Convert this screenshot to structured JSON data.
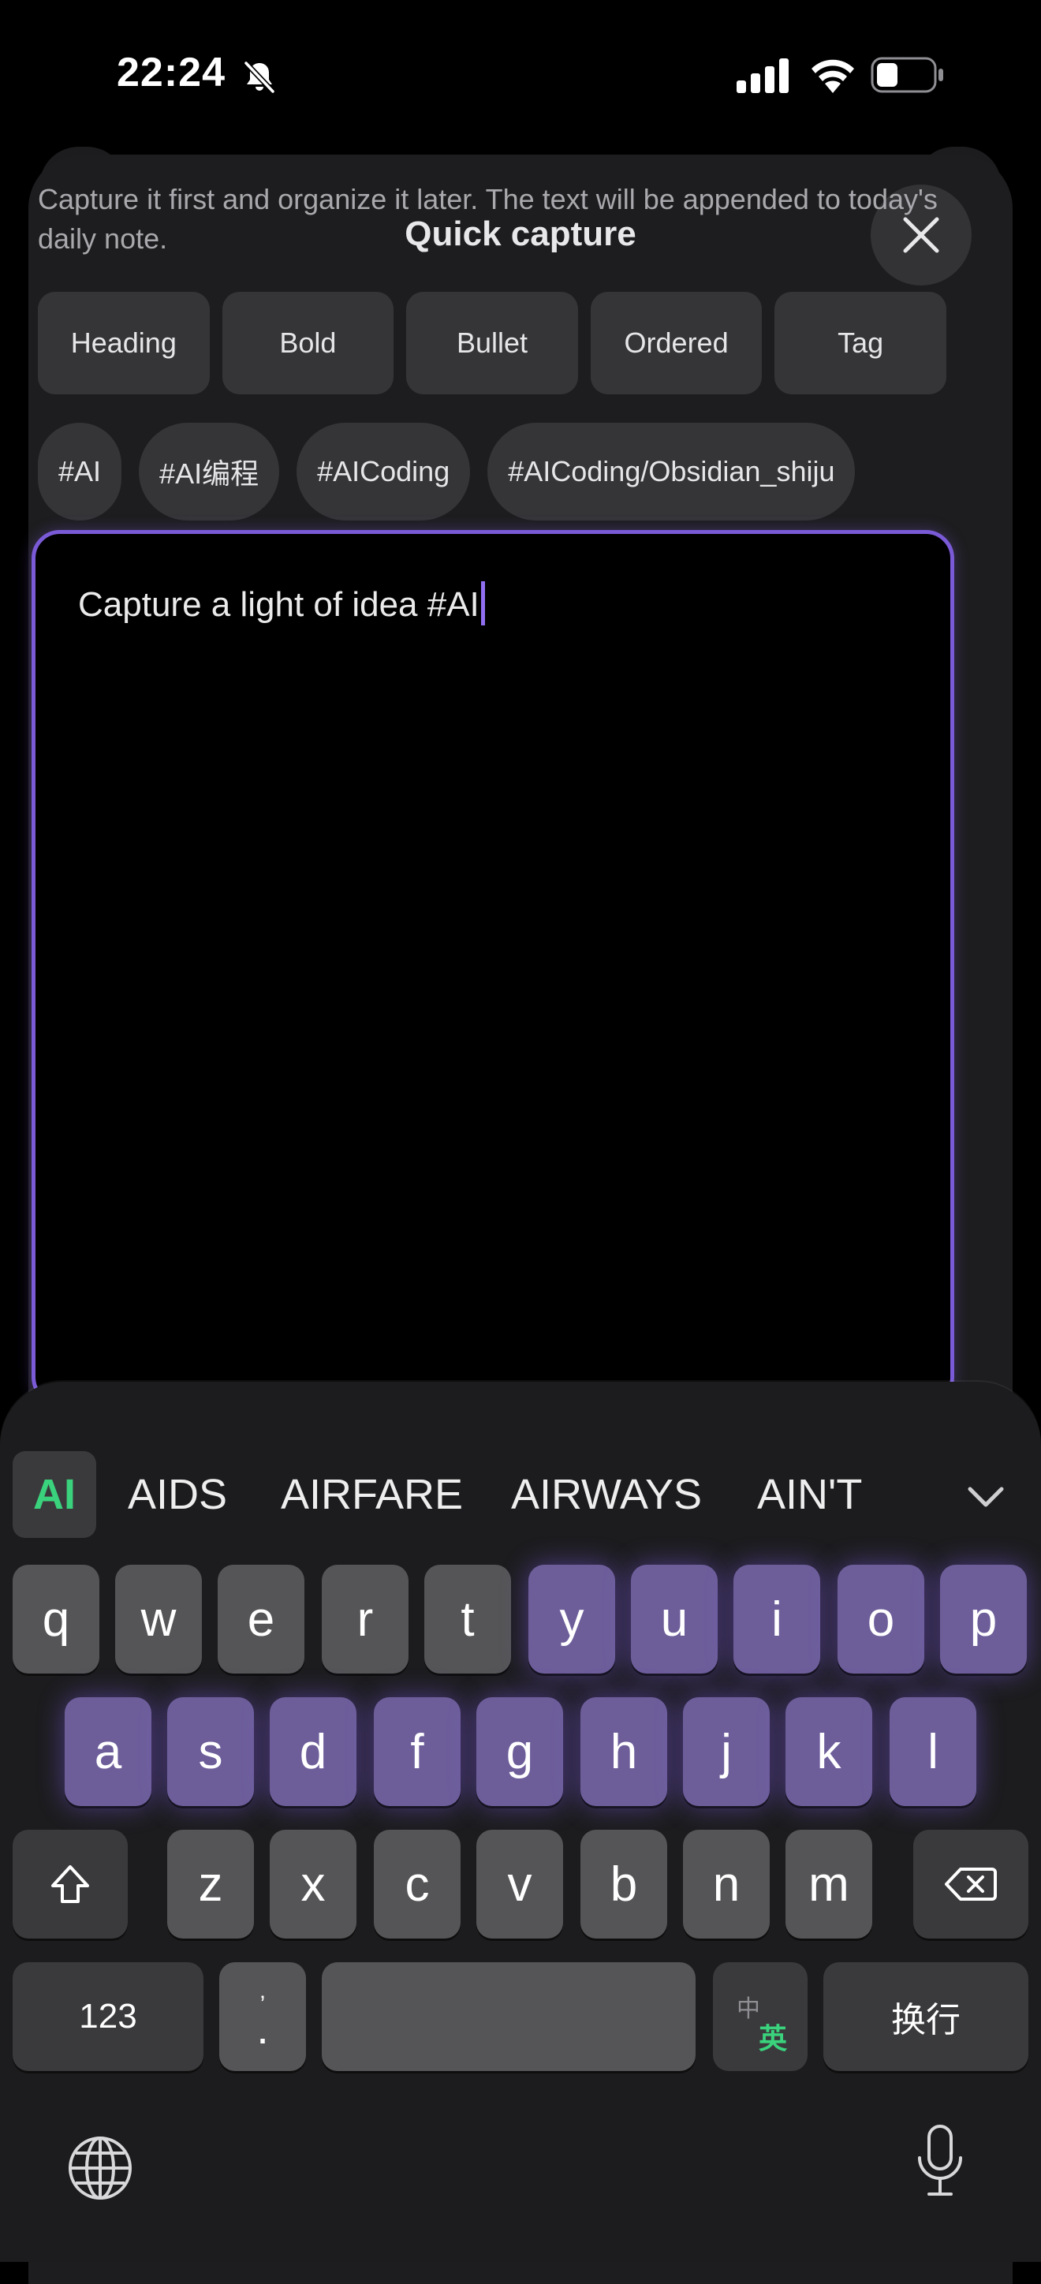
{
  "status_bar": {
    "time": "22:24",
    "icons": [
      "bell-slash-icon",
      "cellular-signal-icon",
      "wifi-icon",
      "battery-icon"
    ]
  },
  "sheet": {
    "title": "Quick capture",
    "description": "Capture it first and organize it later. The text will be appended to today's daily note.",
    "format_buttons": [
      "Heading",
      "Bold",
      "Bullet",
      "Ordered",
      "Tag"
    ],
    "tags": [
      "#AI",
      "#AI编程",
      "#AICoding",
      "#AICoding/Obsidian_shiju"
    ],
    "editor_text": "Capture a light of idea #AI"
  },
  "keyboard": {
    "suggestions": [
      "AI",
      "AIDS",
      "AIRFARE",
      "AIRWAYS",
      "AIN'T"
    ],
    "row1": [
      "q",
      "w",
      "e",
      "r",
      "t",
      "y",
      "u",
      "i",
      "o",
      "p"
    ],
    "row2": [
      "a",
      "s",
      "d",
      "f",
      "g",
      "h",
      "j",
      "k",
      "l"
    ],
    "row3": [
      "z",
      "x",
      "c",
      "v",
      "b",
      "n",
      "m"
    ],
    "numbers_label": "123",
    "period_label": ".",
    "period_alt": "’",
    "lang_switch_top": "中",
    "lang_switch_bottom": "英",
    "return_label": "换行"
  },
  "colors": {
    "accent_purple": "#7a5ad6",
    "suggestion_green": "#3ad27c",
    "sheet_bg": "#1d1d1f"
  }
}
